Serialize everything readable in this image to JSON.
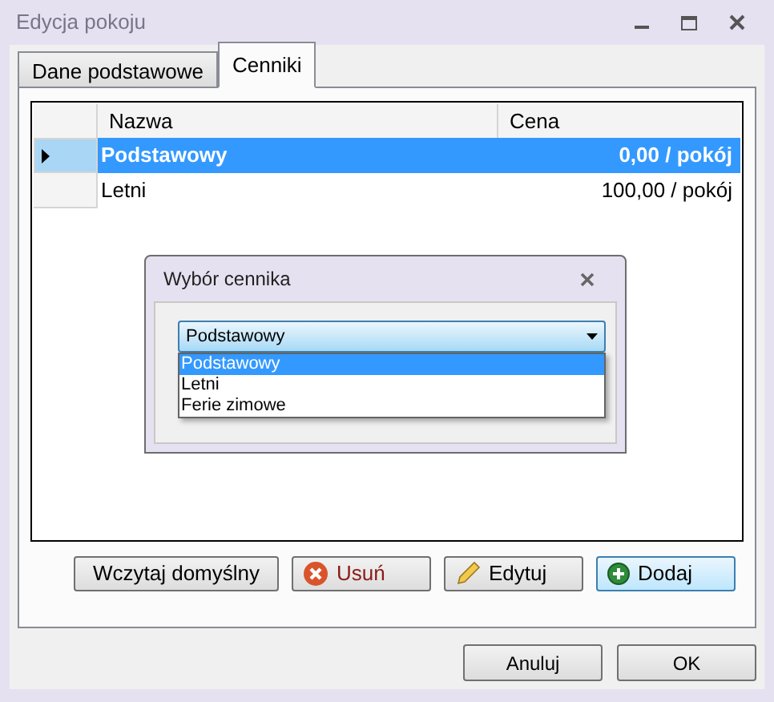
{
  "window": {
    "title": "Edycja pokoju"
  },
  "tabs": [
    {
      "label": "Dane podstawowe",
      "selected": false
    },
    {
      "label": "Cenniki",
      "selected": true
    }
  ],
  "table": {
    "columns": [
      "Nazwa",
      "Cena"
    ],
    "rows": [
      {
        "name": "Podstawowy",
        "price": "0,00 / pokój",
        "selected": true
      },
      {
        "name": "Letni",
        "price": "100,00 / pokój",
        "selected": false
      }
    ]
  },
  "dialog": {
    "title": "Wybór cennika",
    "combo_value": "Podstawowy",
    "options": [
      {
        "label": "Podstawowy",
        "selected": true
      },
      {
        "label": "Letni",
        "selected": false
      },
      {
        "label": "Ferie zimowe",
        "selected": false
      }
    ]
  },
  "actions": [
    {
      "label": "Wczytaj domyślny",
      "kind": "plain",
      "focused": false
    },
    {
      "label": "Usuń",
      "kind": "delete",
      "focused": false
    },
    {
      "label": "Edytuj",
      "kind": "edit",
      "focused": false
    },
    {
      "label": "Dodaj",
      "kind": "add",
      "focused": true
    }
  ],
  "footer_buttons": [
    "Anuluj",
    "OK"
  ]
}
